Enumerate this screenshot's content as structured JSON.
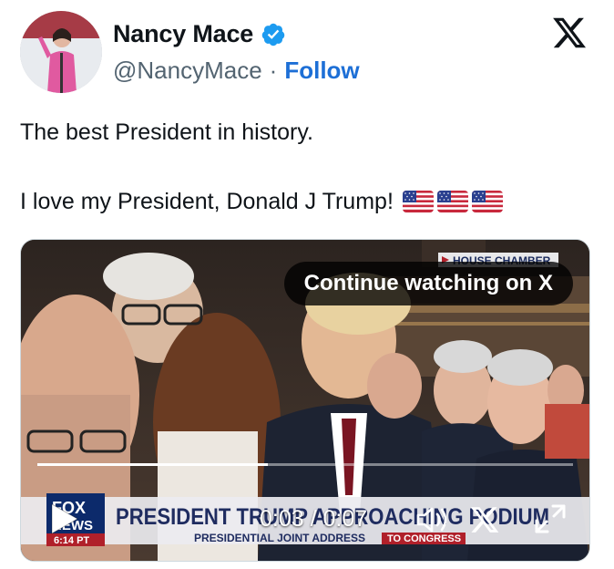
{
  "author": {
    "display_name": "Nancy Mace",
    "handle": "@NancyMace",
    "separator": "·",
    "follow_label": "Follow",
    "verified": true,
    "verified_color": "#1d9bf0"
  },
  "tweet": {
    "line1": "The best President in history.",
    "line2": "I love my President, Donald J Trump!",
    "flags": [
      "us-flag",
      "us-flag",
      "us-flag"
    ]
  },
  "video": {
    "continue_label": "Continue watching on X",
    "time": "0:03 / 0:07",
    "progress": 0.43,
    "overlay": {
      "house_chamber": "HOUSE CHAMBER",
      "fox": "FOX",
      "news": "NEWS",
      "clock": "6:14 PT",
      "headline": "PRESIDENT TRUMP APPROACHING PODIUM",
      "subline": "PRESIDENTIAL JOINT ADDRESS",
      "subline_tag": "TO CONGRESS"
    }
  },
  "icons": {
    "brand": "x-logo-icon",
    "play": "play-icon",
    "volume": "volume-icon",
    "x_small": "x-logo-small-icon",
    "fullscreen": "fullscreen-icon"
  },
  "colors": {
    "text": "#0f1419",
    "muted": "#536471",
    "link": "#1d6fd6"
  }
}
